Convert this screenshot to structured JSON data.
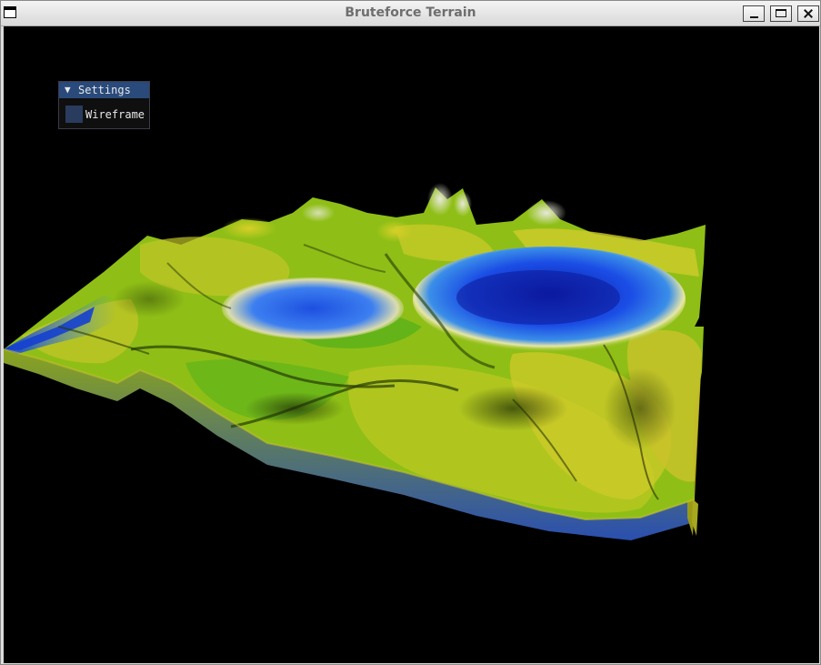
{
  "window": {
    "title": "Bruteforce Terrain",
    "controls": [
      "minimize",
      "maximize",
      "close"
    ]
  },
  "settings_panel": {
    "title": "Settings",
    "collapse_glyph": "▼",
    "wireframe": {
      "label": "Wireframe",
      "checked": false
    }
  },
  "colors": {
    "viewport_background": "#000000",
    "panel_header": "#294a7a",
    "checkbox": "#293c5e",
    "water": "#1a56e0",
    "grass": "#4caf10",
    "highland": "#b8b820"
  }
}
